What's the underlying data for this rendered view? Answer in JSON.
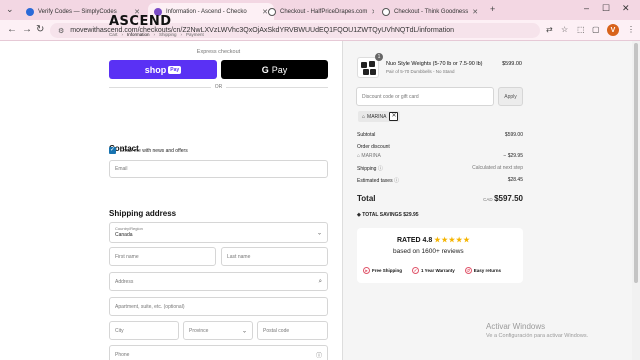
{
  "browser": {
    "tabs": [
      {
        "title": "Verify Codes — SimplyCodes",
        "color": "#2a6ad8"
      },
      {
        "title": "Information - Ascend - Checko",
        "color": "#7a4bc6",
        "active": true
      },
      {
        "title": "Checkout - HalfPriceDrapes.com",
        "color": "#555555"
      },
      {
        "title": "Checkout - Think Goodness",
        "color": "#555555"
      }
    ],
    "new_tab": "+",
    "url": "movewithascend.com/checkouts/cn/Z2NwLXVzLWVhc3QxOjAxSkdYRVBWUUdEQ1FQOU1ZWTQyUVhNQTdL/information",
    "avatar_letter": "V"
  },
  "checkout": {
    "logo": "ASCEND",
    "breadcrumbs": [
      "Cart",
      "Information",
      "Shipping",
      "Payment"
    ],
    "express_label": "Express checkout",
    "shoppay_label": "shop",
    "shoppay_badge": "Pay",
    "gpay_label": "Pay",
    "or_label": "OR",
    "contact_heading": "Contact",
    "email_placeholder": "Email",
    "newsletter_label": "Email me with news and offers",
    "shipping_heading": "Shipping address",
    "country_label": "Country/Region",
    "country_value": "Canada",
    "first_name_placeholder": "First name",
    "last_name_placeholder": "Last name",
    "address_placeholder": "Address",
    "apartment_placeholder": "Apartment, suite, etc. (optional)",
    "city_placeholder": "City",
    "province_placeholder": "Province",
    "postal_placeholder": "Postal code",
    "phone_placeholder": "Phone"
  },
  "summary": {
    "quantity": "1",
    "product_name": "Nuo Style Weights (5-70 lb or 7.5-90 lb)",
    "product_variant": "Pair of 5-70 Dumbbells - No Stand",
    "product_price": "$599.00",
    "discount_placeholder": "Discount code or gift card",
    "apply_label": "Apply",
    "applied_code": "MARINA",
    "subtotal_label": "Subtotal",
    "subtotal_value": "$599.00",
    "order_discount_label": "Order discount",
    "discount_code_label": "MARINA",
    "discount_value": "− $29.95",
    "shipping_label": "Shipping",
    "shipping_value": "Calculated at next step",
    "taxes_label": "Estimated taxes",
    "taxes_value": "$28.45",
    "total_label": "Total",
    "currency": "CAD",
    "total_value": "$597.50",
    "savings_label": "TOTAL SAVINGS",
    "savings_value": "$29.95",
    "rated_label": "RATED 4.8",
    "stars": "★★★★★",
    "based_on": "based on 1600+ reviews",
    "badge_shipping": "Free Shipping",
    "badge_warranty": "1 Year Warranty",
    "badge_returns": "Easy returns"
  },
  "os": {
    "activate_title": "Activar Windows",
    "activate_sub": "Ve a Configuración para activar Windows."
  }
}
